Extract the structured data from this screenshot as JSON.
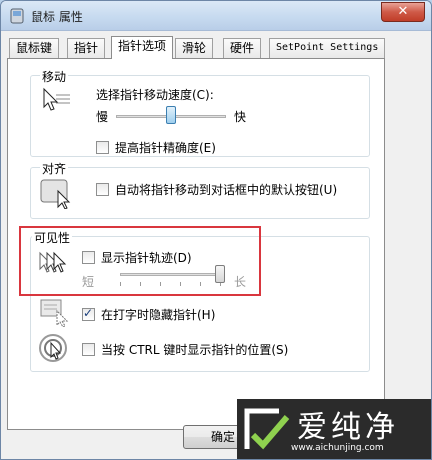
{
  "window": {
    "title": "鼠标 属性",
    "close_label": "✕"
  },
  "tabs": [
    {
      "label": "鼠标键"
    },
    {
      "label": "指针"
    },
    {
      "label": "指针选项"
    },
    {
      "label": "滑轮"
    },
    {
      "label": "硬件"
    },
    {
      "label": "SetPoint Settings"
    }
  ],
  "motion": {
    "group_label": "移动",
    "speed_label": "选择指针移动速度(C):",
    "slow_label": "慢",
    "fast_label": "快",
    "speed_level": 0.5,
    "precision_label": "提高指针精确度(E)",
    "precision_checked": false
  },
  "snap": {
    "group_label": "对齐",
    "snap_label": "自动将指针移动到对话框中的默认按钮(U)",
    "snap_checked": false
  },
  "visibility": {
    "group_label": "可见性",
    "trails_label": "显示指针轨迹(D)",
    "trails_checked": false,
    "short_label": "短",
    "long_label": "长",
    "trail_level": 1.0,
    "hide_label": "在打字时隐藏指针(H)",
    "hide_checked": true,
    "ctrl_label": "当按 CTRL 键时显示指针的位置(S)",
    "ctrl_checked": false
  },
  "buttons": {
    "ok_label": "确定"
  },
  "watermark": {
    "brand": "爱纯净",
    "url": "www.aichunjing.com"
  }
}
